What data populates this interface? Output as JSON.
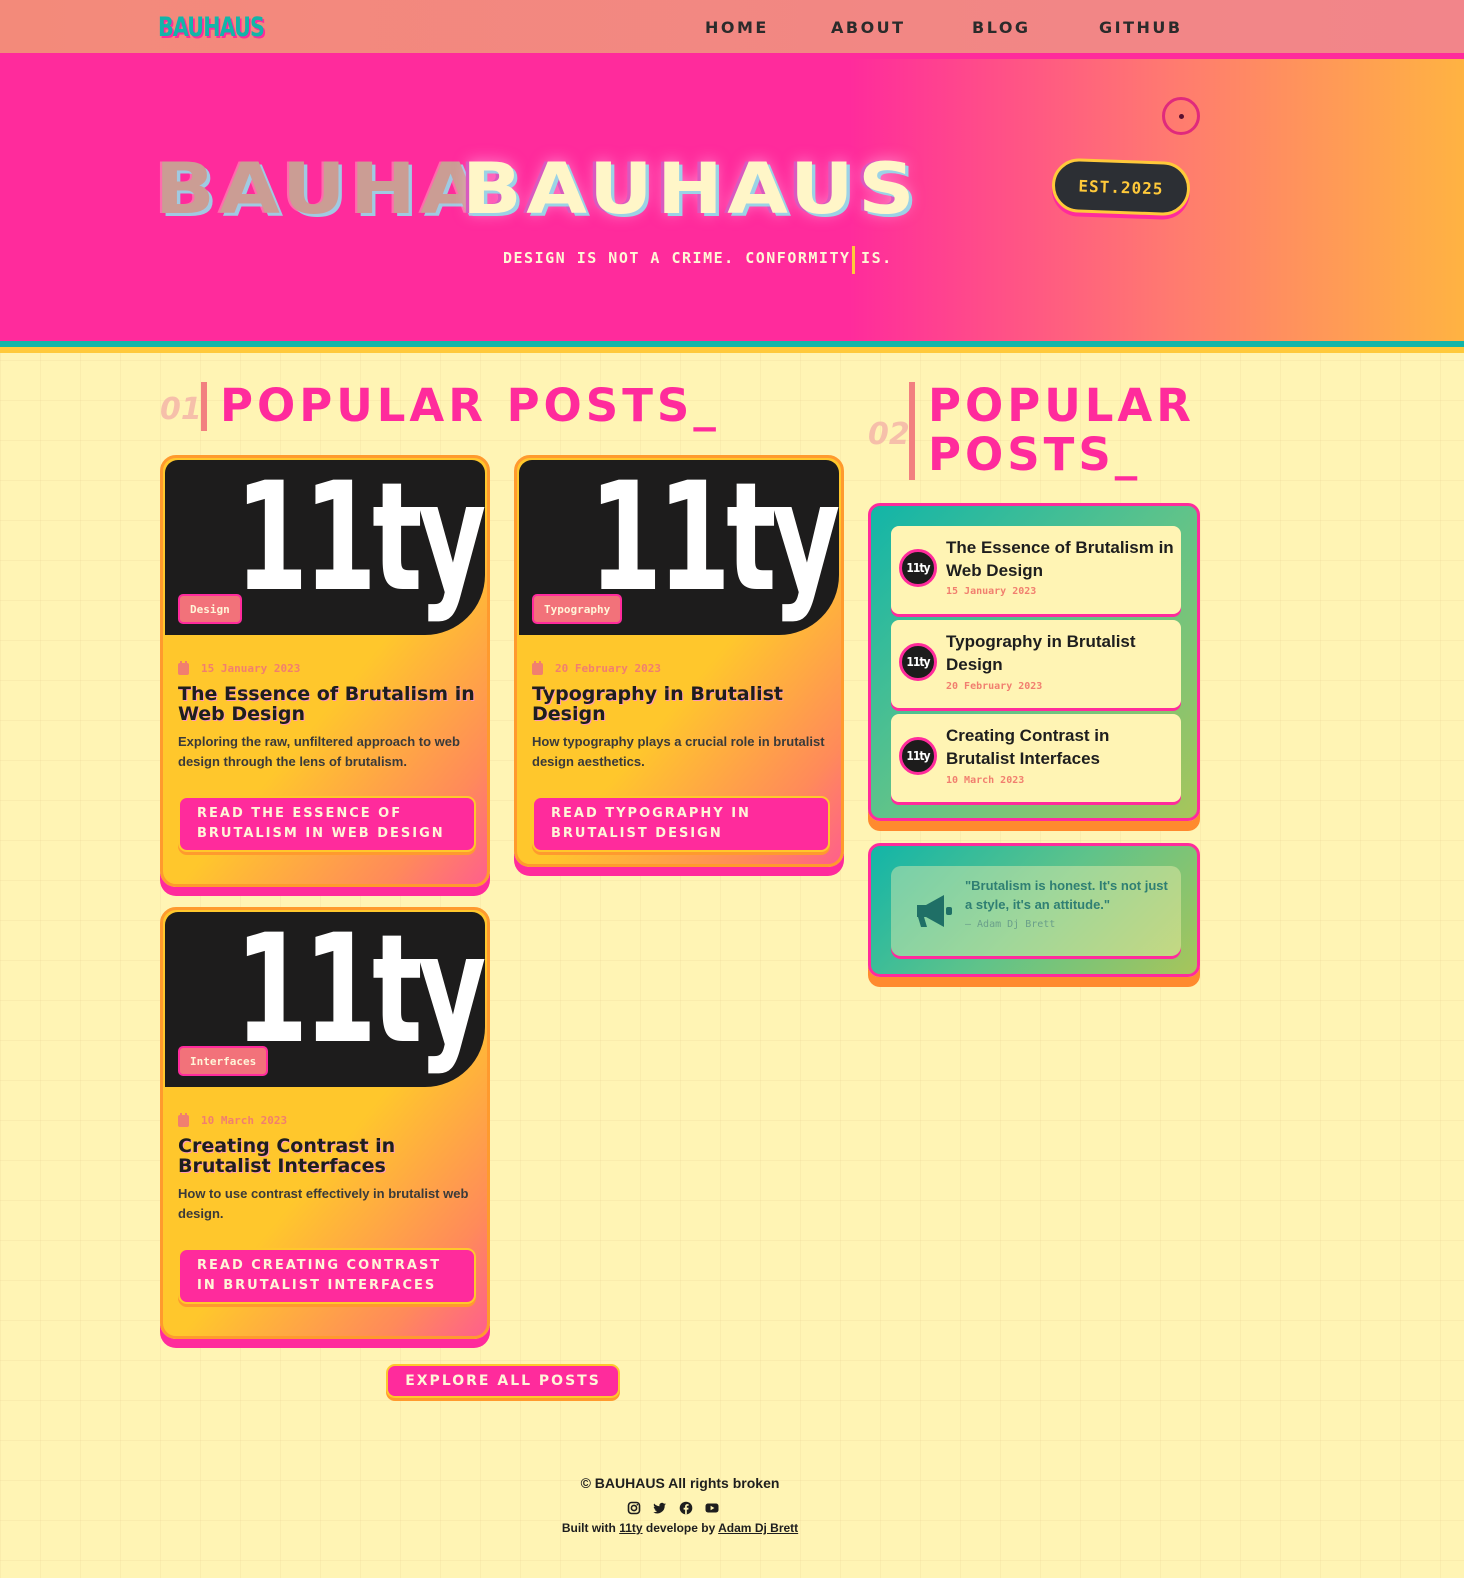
{
  "nav": {
    "logo": "BAUHAUS",
    "items": [
      {
        "label": "HOME"
      },
      {
        "label": "ABOUT"
      },
      {
        "label": "BLOG"
      },
      {
        "label": "GITHUB"
      }
    ]
  },
  "hero": {
    "title_ghost": "BAUHA",
    "title": "BAUHAUS",
    "badge": "EST.2025",
    "tagline": "DESIGN IS NOT A CRIME. CONFORMITY IS."
  },
  "main_section": {
    "number": "01",
    "title": "POPULAR POSTS_"
  },
  "side_section": {
    "number": "02",
    "title_line1": "POPULAR",
    "title_line2": "POSTS_"
  },
  "posts": [
    {
      "image_text": "11ty",
      "tag": "Design",
      "date": "15 January 2023",
      "title": "The Essence of Brutalism in Web Design",
      "description": "Exploring the raw, unfiltered approach to web design through the lens of brutalism.",
      "button": "READ THE ESSENCE OF BRUTALISM IN WEB DESIGN"
    },
    {
      "image_text": "11ty",
      "tag": "Typography",
      "date": "20 February 2023",
      "title": "Typography in Brutalist Design",
      "description": "How typography plays a crucial role in brutalist design aesthetics.",
      "button": "READ TYPOGRAPHY IN BRUTALIST DESIGN"
    },
    {
      "image_text": "11ty",
      "tag": "Interfaces",
      "date": "10 March 2023",
      "title": "Creating Contrast in Brutalist Interfaces",
      "description": "How to use contrast effectively in brutalist web design.",
      "button": "READ CREATING CONTRAST IN BRUTALIST INTERFACES"
    }
  ],
  "sidebar": {
    "items": [
      {
        "avatar": "11ty",
        "title": "The Essence of Brutalism in Web Design",
        "date": "15 January 2023"
      },
      {
        "avatar": "11ty",
        "title": "Typography in Brutalist Design",
        "date": "20 February 2023"
      },
      {
        "avatar": "11ty",
        "title": "Creating Contrast in Brutalist Interfaces",
        "date": "10 March 2023"
      }
    ],
    "quote": {
      "icon": "megaphone-icon",
      "text": "\"Brutalism is honest. It's not just a style, it's an attitude.\"",
      "author": "— Adam Dj Brett"
    }
  },
  "explore_button": "EXPLORE ALL POSTS",
  "footer": {
    "copyright": "© BAUHAUS All rights broken",
    "socials": [
      "instagram-icon",
      "twitter-icon",
      "facebook-icon",
      "youtube-icon"
    ],
    "built_prefix": "Built with",
    "built_link": "11ty",
    "built_middle": "develope by",
    "author_link": "Adam Dj Brett"
  },
  "colors": {
    "pink": "#ff2b9c",
    "teal": "#12b5a8",
    "yellow": "#ffc72c",
    "orange": "#ff9a2e",
    "cream": "#fff4b4",
    "dark": "#1d1c1c"
  }
}
